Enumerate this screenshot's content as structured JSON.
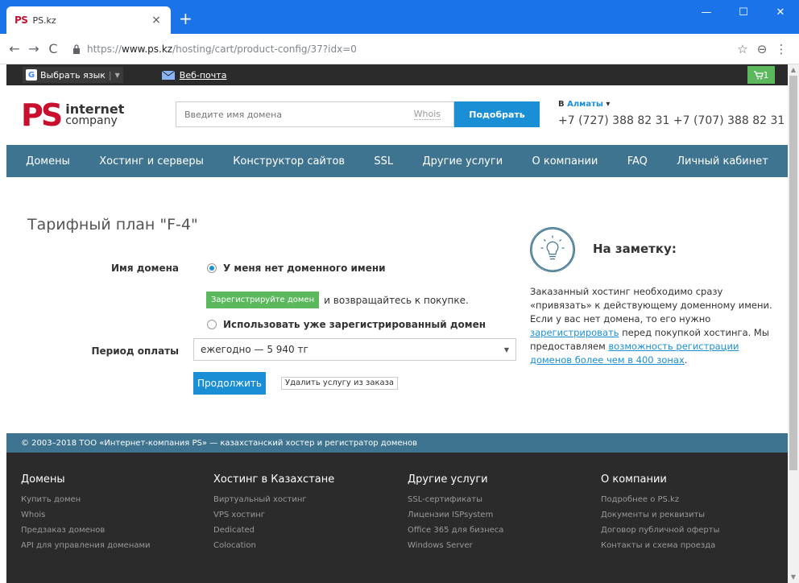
{
  "browser": {
    "tab_favicon": "PS",
    "tab_title": "PS.kz",
    "tab_close": "×",
    "new_tab": "+",
    "url_scheme": "https://",
    "url_host": "www.ps.kz",
    "url_path": "/hosting/cart/product-config/37?idx=0",
    "back": "←",
    "forward": "→",
    "reload": "C",
    "star": "☆",
    "profile": "⊖",
    "menu": "⋮",
    "minimize": "—",
    "maximize": "☐",
    "close": "✕"
  },
  "topstrip": {
    "lang_label": "Выбрать язык",
    "lang_sep": "|",
    "lang_arrow": "▼",
    "mail_link": "Веб-почта",
    "cart_count": "1"
  },
  "header": {
    "logo_ps": "PS",
    "logo_line1": "internet",
    "logo_line2": "company",
    "search_placeholder": "Введите имя домена",
    "whois": "Whois",
    "search_button": "Подобрать",
    "city_prefix": "В",
    "city": "Алматы",
    "city_arrow": "▾",
    "phones": "+7 (727) 388 82 31 +7 (707) 388 82 31"
  },
  "nav": {
    "items": [
      "Домены",
      "Хостинг и серверы",
      "Конструктор сайтов",
      "SSL",
      "Другие услуги",
      "О компании",
      "FAQ",
      "Личный кабинет"
    ]
  },
  "main": {
    "title": "Тарифный план \"F-4\"",
    "domain_label": "Имя домена",
    "option_no_domain": "У меня нет доменного имени",
    "register_button": "Зарегистрируйте домен",
    "register_text": "и возвращайтесь к покупке.",
    "option_use_existing": "Использовать уже зарегистрированный домен",
    "period_label": "Период оплаты",
    "period_value": "ежегодно — 5 940 тг",
    "select_arrow": "▼",
    "continue_button": "Продолжить",
    "remove_button": "Удалить услугу из заказа"
  },
  "note": {
    "title": "На заметку:",
    "text_1": "Заказанный хостинг необходимо сразу «привязать» к действующему доменному имени. Если у вас нет домена, то его нужно ",
    "link_1": "зарегистрировать",
    "text_2": " перед покупкой хостинга. Мы предоставляем ",
    "link_2": "возможность регистрации доменов более чем в 400 зонах",
    "text_3": "."
  },
  "footer": {
    "copyright": "© 2003–2018 ТОО «Интернет-компания PS» — казахстанский хостер и регистратор доменов",
    "columns": [
      {
        "title": "Домены",
        "links": [
          "Купить домен",
          "Whois",
          "Предзаказ доменов",
          "API для управления доменами"
        ]
      },
      {
        "title": "Хостинг в Казахстане",
        "links": [
          "Виртуальный хостинг",
          "VPS хостинг",
          "Dedicated",
          "Colocation"
        ]
      },
      {
        "title": "Другие услуги",
        "links": [
          "SSL-сертификаты",
          "Лицензии ISPsystem",
          "Office 365 для бизнеса",
          "Windows Server"
        ]
      },
      {
        "title": "О компании",
        "links": [
          "Подробнее о PS.kz",
          "Документы и реквизиты",
          "Договор публичной оферты",
          "Контакты и схема проезда"
        ]
      }
    ]
  },
  "colors": {
    "browser_blue": "#1a73e8",
    "brand_red": "#c8102e",
    "nav_blue": "#3f7490",
    "accent_blue": "#1a8fd6",
    "green": "#5cb85c",
    "dark": "#2b2b2b"
  }
}
